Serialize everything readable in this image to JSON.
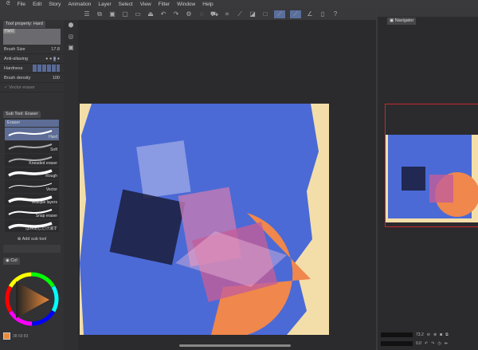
{
  "menu": [
    "File",
    "Edit",
    "Story",
    "Animation",
    "Layer",
    "Select",
    "View",
    "Filter",
    "Window",
    "Help"
  ],
  "tool_property": {
    "tab": "Tool property: Hard",
    "preset": "Hard",
    "brush_size_label": "Brush Size",
    "brush_size": "17.8",
    "anti_aliasing_label": "Anti-aliasing",
    "hardness_label": "Hardness",
    "brush_density_label": "Brush density",
    "brush_density": "100",
    "vector_eraser_label": "Vector eraser"
  },
  "sub_tool": {
    "tab": "Sub Tool: Eraser",
    "group": "Eraser",
    "items": [
      "Hard",
      "Soft",
      "Kneaded eraser",
      "Rough",
      "Vector",
      "Multiple layers",
      "Snap eraser",
      "はみ出しだけ消す"
    ],
    "add_label": "Add sub tool"
  },
  "color": {
    "tab": "Col",
    "values": "38 69 83",
    "main_color": "#e88a3c"
  },
  "navigator": {
    "tab": "Navigator",
    "zoom": "73.2",
    "rotation": "0.0"
  }
}
